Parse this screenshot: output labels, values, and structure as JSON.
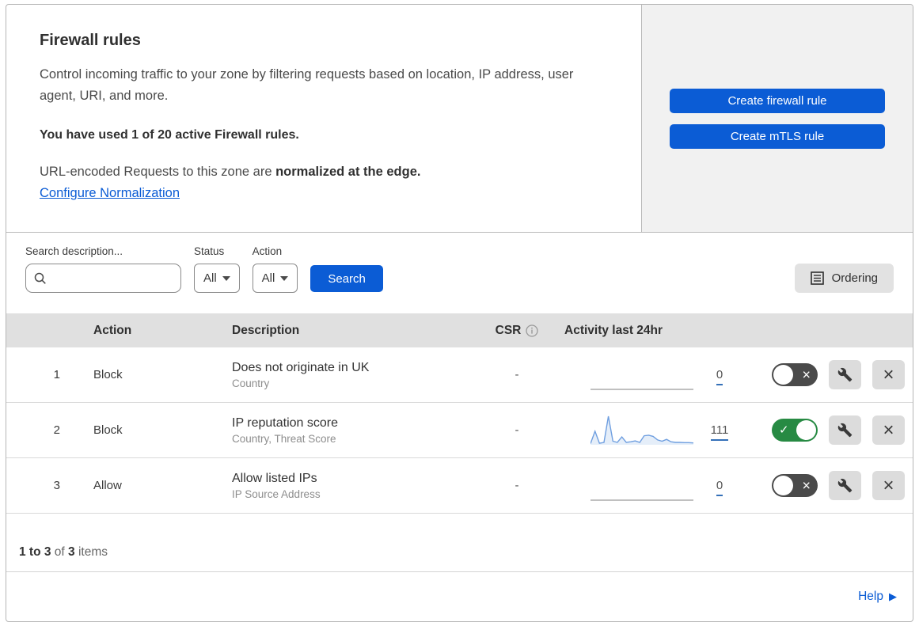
{
  "colors": {
    "accent_blue": "#0b5cd5",
    "link_blue": "#0b5cd5",
    "toggle_on_green": "#278a43",
    "toggle_off_gray": "#4a4a4a",
    "sparkline_blue": "#6f9fe0",
    "table_header_gray": "#e0e0e0"
  },
  "header": {
    "title": "Firewall rules",
    "description": "Control incoming traffic to your zone by filtering requests based on location, IP address, user agent, URI, and more.",
    "usage": "You have used 1 of 20 active Firewall rules.",
    "normalization_text": "URL-encoded Requests to this zone are ",
    "normalization_bold": "normalized at the edge.",
    "normalization_link": "Configure Normalization"
  },
  "actions_panel": {
    "create_firewall_rule": "Create firewall rule",
    "create_mtls_rule": "Create mTLS rule"
  },
  "filters": {
    "search_label": "Search description...",
    "status_label": "Status",
    "status_value": "All",
    "action_label": "Action",
    "action_value": "All",
    "search_button": "Search",
    "ordering_button": "Ordering"
  },
  "table": {
    "columns": {
      "action": "Action",
      "description": "Description",
      "csr": "CSR",
      "activity": "Activity last 24hr"
    },
    "rows": [
      {
        "index": "1",
        "action": "Block",
        "description": "Does not originate in UK",
        "criteria": "Country",
        "csr": "-",
        "count": "0",
        "enabled": false,
        "activity_values": null
      },
      {
        "index": "2",
        "action": "Block",
        "description": "IP reputation score",
        "criteria": "Country, Threat Score",
        "csr": "-",
        "count": "111",
        "enabled": true,
        "activity_values": [
          4,
          45,
          5,
          8,
          95,
          12,
          8,
          26,
          8,
          10,
          13,
          8,
          30,
          32,
          28,
          16,
          12,
          18,
          10,
          8,
          8,
          7,
          7,
          6
        ]
      },
      {
        "index": "3",
        "action": "Allow",
        "description": "Allow listed IPs",
        "criteria": "IP Source Address",
        "csr": "-",
        "count": "0",
        "enabled": false,
        "activity_values": null
      }
    ]
  },
  "toggle_glyphs": {
    "on": "✓",
    "off": "×"
  },
  "footer": {
    "range_bold": "1 to 3",
    "of_text": " of ",
    "total_bold": "3",
    "items_text": " items",
    "help_label": "Help",
    "help_arrow": "▶"
  }
}
